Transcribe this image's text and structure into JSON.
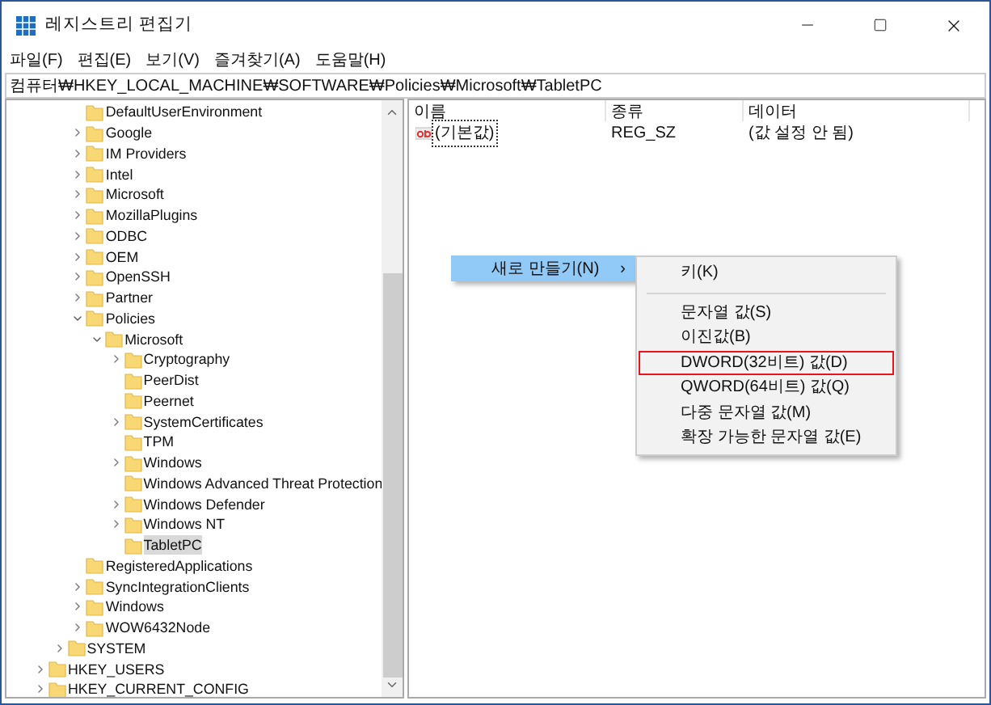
{
  "window": {
    "title": "레지스트리 편집기"
  },
  "menu": [
    "파일(F)",
    "편집(E)",
    "보기(V)",
    "즐겨찾기(A)",
    "도움말(H)"
  ],
  "address": "컴퓨터₩HKEY_LOCAL_MACHINE₩SOFTWARE₩Policies₩Microsoft₩TabletPC",
  "tree": [
    {
      "children": [
        {
          "children": [
            {
              "label": "DefaultUserEnvironment",
              "selected": false
            },
            {
              "label": "Google",
              "expanded": false,
              "selected": false
            },
            {
              "label": "IM Providers",
              "expanded": false,
              "selected": false
            },
            {
              "label": "Intel",
              "expanded": false,
              "selected": false
            },
            {
              "label": "Microsoft",
              "expanded": false,
              "selected": false
            },
            {
              "label": "MozillaPlugins",
              "expanded": false,
              "selected": false
            },
            {
              "label": "ODBC",
              "expanded": false,
              "selected": false
            },
            {
              "label": "OEM",
              "expanded": false,
              "selected": false
            },
            {
              "label": "OpenSSH",
              "expanded": false,
              "selected": false
            },
            {
              "label": "Partner",
              "expanded": false,
              "selected": false
            },
            {
              "label": "Policies",
              "expanded": true,
              "selected": false,
              "children": [
                {
                  "label": "Microsoft",
                  "expanded": true,
                  "selected": false,
                  "children": [
                    {
                      "label": "Cryptography",
                      "expanded": false,
                      "selected": false
                    },
                    {
                      "label": "PeerDist",
                      "selected": false
                    },
                    {
                      "label": "Peernet",
                      "selected": false
                    },
                    {
                      "label": "SystemCertificates",
                      "expanded": false,
                      "selected": false
                    },
                    {
                      "label": "TPM",
                      "selected": false
                    },
                    {
                      "label": "Windows",
                      "expanded": false,
                      "selected": false
                    },
                    {
                      "label": "Windows Advanced Threat Protection",
                      "selected": false
                    },
                    {
                      "label": "Windows Defender",
                      "expanded": false,
                      "selected": false
                    },
                    {
                      "label": "Windows NT",
                      "expanded": false,
                      "selected": false
                    },
                    {
                      "label": "TabletPC",
                      "selected": true
                    }
                  ]
                }
              ]
            },
            {
              "label": "RegisteredApplications",
              "selected": false
            },
            {
              "label": "SyncIntegrationClients",
              "expanded": false,
              "selected": false
            },
            {
              "label": "Windows",
              "expanded": false,
              "selected": false
            },
            {
              "label": "WOW6432Node",
              "expanded": false,
              "selected": false
            }
          ]
        },
        {
          "label": "SYSTEM",
          "expanded": false,
          "selected": false
        }
      ]
    },
    {
      "label": "HKEY_USERS",
      "expanded": false,
      "selected": false
    },
    {
      "label": "HKEY_CURRENT_CONFIG",
      "expanded": false,
      "selected": false
    }
  ],
  "values": {
    "columns": [
      "이름",
      "종류",
      "데이터"
    ],
    "rows": [
      {
        "name": "(기본값)",
        "type": "REG_SZ",
        "data": "(값 설정 안 됨)",
        "focused": true
      }
    ]
  },
  "context_menu": {
    "item": {
      "label": "새로 만들기(N)",
      "arrow": "›",
      "selected": true
    },
    "submenu": [
      {
        "kind": "item",
        "label": "키(K)",
        "highlighted": false
      },
      {
        "kind": "separator"
      },
      {
        "kind": "item",
        "label": "문자열 값(S)",
        "highlighted": false
      },
      {
        "kind": "item",
        "label": "이진값(B)",
        "highlighted": false
      },
      {
        "kind": "item",
        "label": "DWORD(32비트) 값(D)",
        "highlighted": true
      },
      {
        "kind": "item",
        "label": "QWORD(64비트) 값(Q)",
        "highlighted": false
      },
      {
        "kind": "item",
        "label": "다중 문자열 값(M)",
        "highlighted": false
      },
      {
        "kind": "item",
        "label": "확장 가능한 문자열 값(E)",
        "highlighted": false
      }
    ]
  }
}
